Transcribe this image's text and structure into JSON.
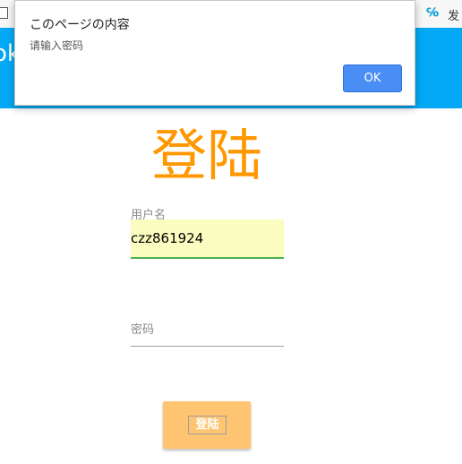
{
  "browser": {
    "extension_label": "发"
  },
  "app_header": {
    "title_fragment": "ok"
  },
  "login": {
    "title": "登陆",
    "username": {
      "label": "用户名",
      "value": "czz861924"
    },
    "password": {
      "label": "密码",
      "value": ""
    },
    "submit_label": "登陆"
  },
  "alert": {
    "title": "このページの内容",
    "message": "请输入密码",
    "ok_label": "OK"
  },
  "colors": {
    "header_bg": "#03a9f4",
    "title_orange": "#ff9800",
    "button_bg": "#ffc471",
    "ok_blue": "#4a8ef5",
    "username_underline": "#4caf50"
  }
}
